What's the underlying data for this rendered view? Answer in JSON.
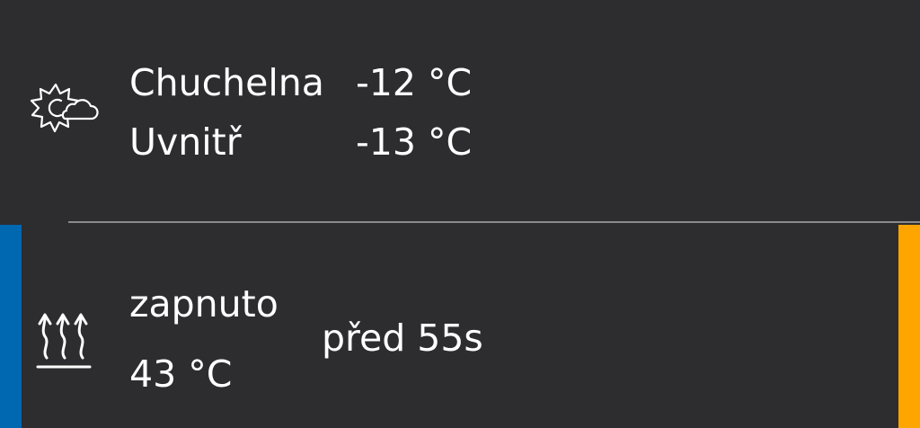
{
  "weather": {
    "icon": "partly-cloudy-sun-icon",
    "rows": [
      {
        "label": "Chuchelna",
        "value": "-12 °C"
      },
      {
        "label": "Uvnitř",
        "value": "-13 °C"
      }
    ]
  },
  "heating": {
    "icon": "heating-icon",
    "status": "zapnuto",
    "temperature": "43 °C",
    "last_update": "před 55s",
    "accent_left_color": "#0067b1",
    "accent_right_color": "#ffa500"
  }
}
